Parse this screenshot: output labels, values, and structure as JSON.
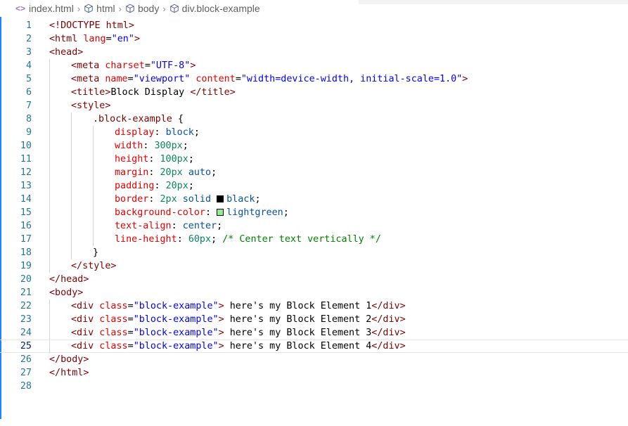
{
  "breadcrumb": {
    "file": "index.html",
    "items": [
      "html",
      "body",
      "div.block-example"
    ]
  },
  "colors": {
    "accent": "#1a85ff",
    "black_swatch": "#000000",
    "lightgreen_swatch": "#90ee90"
  },
  "editor": {
    "current_line": 25,
    "line_numbers": [
      "1",
      "2",
      "3",
      "4",
      "5",
      "6",
      "7",
      "8",
      "9",
      "10",
      "11",
      "12",
      "13",
      "14",
      "15",
      "16",
      "17",
      "18",
      "19",
      "20",
      "21",
      "22",
      "23",
      "24",
      "25",
      "26",
      "27",
      "28"
    ],
    "lines": [
      [
        {
          "t": "<!DOCTYPE html>",
          "c": "tag"
        }
      ],
      [
        {
          "t": "<html",
          "c": "tag"
        },
        {
          "t": " lang",
          "c": "attr"
        },
        {
          "t": "=",
          "c": "punc"
        },
        {
          "t": "\"en\"",
          "c": "str"
        },
        {
          "t": ">",
          "c": "tag"
        }
      ],
      [
        {
          "t": "<head>",
          "c": "tag"
        }
      ],
      [
        {
          "t": "<meta",
          "c": "tag"
        },
        {
          "t": " charset",
          "c": "attr"
        },
        {
          "t": "=",
          "c": "punc"
        },
        {
          "t": "\"UTF-8\"",
          "c": "str"
        },
        {
          "t": ">",
          "c": "tag"
        }
      ],
      [
        {
          "t": "<meta",
          "c": "tag"
        },
        {
          "t": " name",
          "c": "attr"
        },
        {
          "t": "=",
          "c": "punc"
        },
        {
          "t": "\"viewport\"",
          "c": "str"
        },
        {
          "t": " content",
          "c": "attr"
        },
        {
          "t": "=",
          "c": "punc"
        },
        {
          "t": "\"width=device-width, initial-scale=1.0\"",
          "c": "str"
        },
        {
          "t": ">",
          "c": "tag"
        }
      ],
      [
        {
          "t": "<title>",
          "c": "tag"
        },
        {
          "t": "Block Display ",
          "c": "text"
        },
        {
          "t": "</title>",
          "c": "tag"
        }
      ],
      [
        {
          "t": "<style>",
          "c": "tag"
        }
      ],
      [
        {
          "t": ".block-example",
          "c": "sel"
        },
        {
          "t": " {",
          "c": "punc"
        }
      ],
      [
        {
          "t": "display",
          "c": "prop"
        },
        {
          "t": ": ",
          "c": "punc"
        },
        {
          "t": "block",
          "c": "val"
        },
        {
          "t": ";",
          "c": "punc"
        }
      ],
      [
        {
          "t": "width",
          "c": "prop"
        },
        {
          "t": ": ",
          "c": "punc"
        },
        {
          "t": "300px",
          "c": "num"
        },
        {
          "t": ";",
          "c": "punc"
        }
      ],
      [
        {
          "t": "height",
          "c": "prop"
        },
        {
          "t": ": ",
          "c": "punc"
        },
        {
          "t": "100px",
          "c": "num"
        },
        {
          "t": ";",
          "c": "punc"
        }
      ],
      [
        {
          "t": "margin",
          "c": "prop"
        },
        {
          "t": ": ",
          "c": "punc"
        },
        {
          "t": "20px",
          "c": "num"
        },
        {
          "t": " ",
          "c": "punc"
        },
        {
          "t": "auto",
          "c": "val"
        },
        {
          "t": ";",
          "c": "punc"
        }
      ],
      [
        {
          "t": "padding",
          "c": "prop"
        },
        {
          "t": ": ",
          "c": "punc"
        },
        {
          "t": "20px",
          "c": "num"
        },
        {
          "t": ";",
          "c": "punc"
        }
      ],
      [
        {
          "t": "border",
          "c": "prop"
        },
        {
          "t": ": ",
          "c": "punc"
        },
        {
          "t": "2px",
          "c": "num"
        },
        {
          "t": " ",
          "c": "punc"
        },
        {
          "t": "solid",
          "c": "val"
        },
        {
          "t": " ",
          "c": "punc"
        },
        {
          "swatch": "black_swatch"
        },
        {
          "t": "black",
          "c": "val"
        },
        {
          "t": ";",
          "c": "punc"
        }
      ],
      [
        {
          "t": "background-color",
          "c": "prop"
        },
        {
          "t": ": ",
          "c": "punc"
        },
        {
          "swatch": "lightgreen_swatch"
        },
        {
          "t": "lightgreen",
          "c": "val"
        },
        {
          "t": ";",
          "c": "punc"
        }
      ],
      [
        {
          "t": "text-align",
          "c": "prop"
        },
        {
          "t": ": ",
          "c": "punc"
        },
        {
          "t": "center",
          "c": "val"
        },
        {
          "t": ";",
          "c": "punc"
        }
      ],
      [
        {
          "t": "line-height",
          "c": "prop"
        },
        {
          "t": ": ",
          "c": "punc"
        },
        {
          "t": "60px",
          "c": "num"
        },
        {
          "t": "; ",
          "c": "punc"
        },
        {
          "t": "/* Center text vertically */",
          "c": "cmt"
        }
      ],
      [
        {
          "t": "}",
          "c": "punc"
        }
      ],
      [
        {
          "t": "</style>",
          "c": "tag"
        }
      ],
      [
        {
          "t": "</head>",
          "c": "tag"
        }
      ],
      [
        {
          "t": "<body>",
          "c": "tag"
        }
      ],
      [
        {
          "t": "<div",
          "c": "tag"
        },
        {
          "t": " class",
          "c": "attr"
        },
        {
          "t": "=",
          "c": "punc"
        },
        {
          "t": "\"block-example\"",
          "c": "str"
        },
        {
          "t": ">",
          "c": "tag"
        },
        {
          "t": " here's my Block Element 1",
          "c": "text"
        },
        {
          "t": "</div>",
          "c": "tag"
        }
      ],
      [
        {
          "t": "<div",
          "c": "tag"
        },
        {
          "t": " class",
          "c": "attr"
        },
        {
          "t": "=",
          "c": "punc"
        },
        {
          "t": "\"block-example\"",
          "c": "str"
        },
        {
          "t": ">",
          "c": "tag"
        },
        {
          "t": " here's my Block Element 2",
          "c": "text"
        },
        {
          "t": "</div>",
          "c": "tag"
        }
      ],
      [
        {
          "t": "<div",
          "c": "tag"
        },
        {
          "t": " class",
          "c": "attr"
        },
        {
          "t": "=",
          "c": "punc"
        },
        {
          "t": "\"block-example\"",
          "c": "str"
        },
        {
          "t": ">",
          "c": "tag"
        },
        {
          "t": " here's my Block Element 3",
          "c": "text"
        },
        {
          "t": "</div>",
          "c": "tag"
        }
      ],
      [
        {
          "t": "<div",
          "c": "tag"
        },
        {
          "t": " class",
          "c": "attr"
        },
        {
          "t": "=",
          "c": "punc"
        },
        {
          "t": "\"block-example\"",
          "c": "str"
        },
        {
          "t": ">",
          "c": "tag"
        },
        {
          "t": " here's my Block Element 4",
          "c": "text"
        },
        {
          "t": "</div>",
          "c": "tag"
        }
      ],
      [
        {
          "t": "</body>",
          "c": "tag"
        }
      ],
      [
        {
          "t": "</html>",
          "c": "tag"
        }
      ],
      []
    ]
  }
}
